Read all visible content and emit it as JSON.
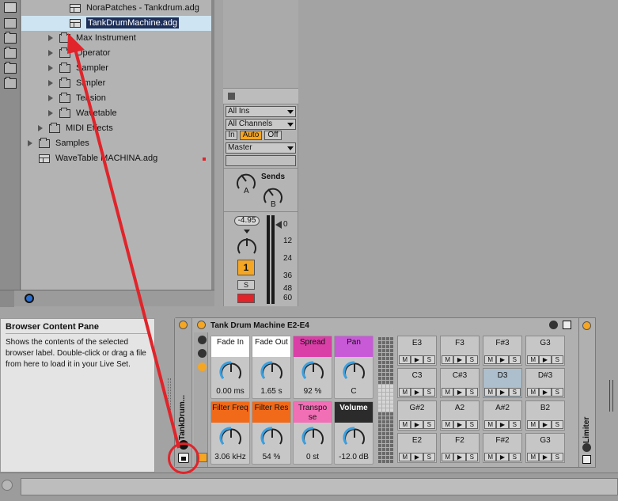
{
  "browser": {
    "rows": [
      {
        "label": "NoraPatches - Tankdrum.adg",
        "kind": "file",
        "indent": 3
      },
      {
        "label": "TankDrumMachine.adg",
        "kind": "file",
        "indent": 3,
        "selected": true
      },
      {
        "label": "Max Instrument",
        "kind": "folder",
        "indent": 2
      },
      {
        "label": "Operator",
        "kind": "folder",
        "indent": 2
      },
      {
        "label": "Sampler",
        "kind": "folder",
        "indent": 2
      },
      {
        "label": "Simpler",
        "kind": "folder",
        "indent": 2
      },
      {
        "label": "Tension",
        "kind": "folder",
        "indent": 2
      },
      {
        "label": "Wavetable",
        "kind": "folder",
        "indent": 2
      },
      {
        "label": "MIDI Effects",
        "kind": "folder",
        "indent": 1
      },
      {
        "label": "Samples",
        "kind": "folder",
        "indent": 0
      },
      {
        "label": "WaveTable MACHINA.adg",
        "kind": "file",
        "indent": 0,
        "dot": true
      }
    ]
  },
  "mixer": {
    "input_type": "All Ins",
    "input_channel": "All Channels",
    "monitor": {
      "in": "In",
      "auto": "Auto",
      "off": "Off"
    },
    "output": "Master",
    "sends_label": "Sends",
    "send_a": "A",
    "send_b": "B",
    "volume": "-4.95",
    "track_number": "1",
    "solo": "S",
    "db_scale": [
      "0",
      "12",
      "24",
      "36",
      "48",
      "60"
    ]
  },
  "info": {
    "title": "Browser Content Pane",
    "text": "Shows the contents of the selected browser label. Double-click or drag a file from here to load it in your Live Set."
  },
  "rack": {
    "chain_name": "TankDrum...",
    "title": "Tank Drum Machine E2-E4",
    "macros": [
      {
        "label": "Fade In",
        "value": "0.00 ms",
        "color": "#ffffff"
      },
      {
        "label": "Fade Out",
        "value": "1.65 s",
        "color": "#ffffff"
      },
      {
        "label": "Spread",
        "value": "92 %",
        "color": "#d93fa6"
      },
      {
        "label": "Pan",
        "value": "C",
        "color": "#c85ad8"
      },
      {
        "label": "Filter Freq",
        "value": "3.06 kHz",
        "color": "#f06a1a"
      },
      {
        "label": "Filter Res",
        "value": "54 %",
        "color": "#f06a1a"
      },
      {
        "label": "Transpo se",
        "value": "0 st",
        "color": "#f16fb5"
      },
      {
        "label": "Volume",
        "value": "-12.0 dB",
        "color": "#2b2b2b"
      }
    ],
    "pads": [
      [
        "E3",
        "F3",
        "F#3",
        "G3"
      ],
      [
        "C3",
        "C#3",
        "D3",
        "D#3"
      ],
      [
        "G#2",
        "A2",
        "A#2",
        "B2"
      ],
      [
        "E2",
        "F2",
        "F#2",
        "G3"
      ]
    ],
    "pad_buttons": [
      "M",
      "▶",
      "S"
    ],
    "limiter": "Limiter"
  },
  "colors": {
    "accent": "#f5a623",
    "annotation": "#e0242a",
    "selection": "#1d2f59"
  }
}
